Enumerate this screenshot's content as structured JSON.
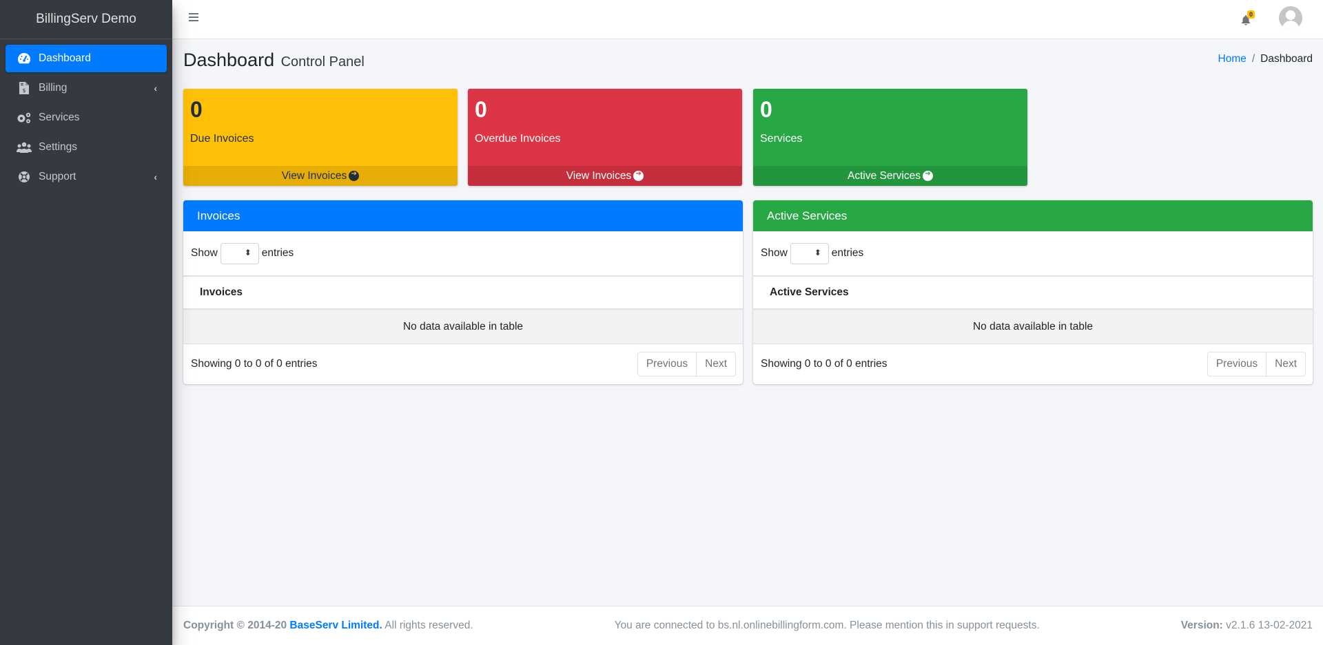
{
  "app": {
    "brand": "BillingServ Demo"
  },
  "sidebar": {
    "items": [
      {
        "label": "Dashboard",
        "icon": "tachometer-icon",
        "active": true,
        "has_submenu": false
      },
      {
        "label": "Billing",
        "icon": "invoice-dollar-icon",
        "active": false,
        "has_submenu": true
      },
      {
        "label": "Services",
        "icon": "cogs-icon",
        "active": false,
        "has_submenu": false
      },
      {
        "label": "Settings",
        "icon": "users-icon",
        "active": false,
        "has_submenu": false
      },
      {
        "label": "Support",
        "icon": "life-ring-icon",
        "active": false,
        "has_submenu": true
      }
    ],
    "chevron": "‹"
  },
  "header": {
    "menu_icon": "bars-icon",
    "notifications_count": "0",
    "avatar_icon": "user-avatar-icon"
  },
  "page": {
    "title": "Dashboard",
    "subtitle": "Control Panel",
    "breadcrumb": [
      {
        "label": "Home",
        "link": true
      },
      {
        "label": "Dashboard",
        "link": false
      }
    ],
    "breadcrumb_separator": "/"
  },
  "stats": [
    {
      "value": "0",
      "label": "Due Invoices",
      "action": "View Invoices",
      "color": "#ffc107"
    },
    {
      "value": "0",
      "label": "Overdue Invoices",
      "action": "View Invoices",
      "color": "#dc3545"
    },
    {
      "value": "0",
      "label": "Services",
      "action": "Active Services",
      "color": "#28a745"
    }
  ],
  "tables": [
    {
      "title": "Invoices",
      "header_color": "#007bff",
      "show_label": "Show",
      "entries_label": "entries",
      "length_value": "",
      "columns": [
        "Invoices"
      ],
      "empty_text": "No data available in table",
      "info": "Showing 0 to 0 of 0 entries",
      "prev_label": "Previous",
      "next_label": "Next"
    },
    {
      "title": "Active Services",
      "header_color": "#28a745",
      "show_label": "Show",
      "entries_label": "entries",
      "length_value": "",
      "columns": [
        "Active Services"
      ],
      "empty_text": "No data available in table",
      "info": "Showing 0 to 0 of 0 entries",
      "prev_label": "Previous",
      "next_label": "Next"
    }
  ],
  "footer": {
    "copyright_prefix": "Copyright © 2014-20",
    "company": "BaseServ Limited.",
    "rights": "All rights reserved.",
    "connection_note": "You are connected to bs.nl.onlinebillingform.com. Please mention this in support requests.",
    "version_label": "Version:",
    "version_value": "v2.1.6 13-02-2021"
  }
}
